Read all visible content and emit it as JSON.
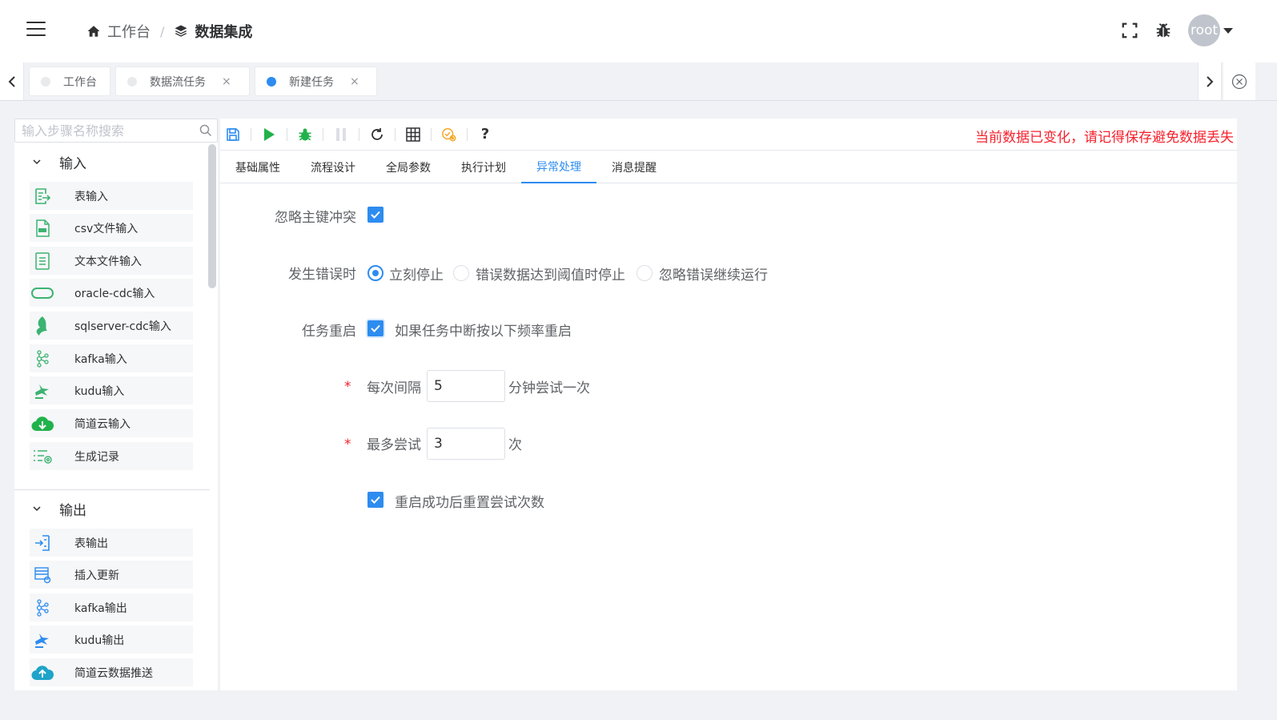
{
  "header": {
    "breadcrumb_home": "工作台",
    "breadcrumb_separator": "/",
    "breadcrumb_current": "数据集成",
    "user_name": "root",
    "icons": [
      "menu-icon",
      "home-icon",
      "layers-icon",
      "fullscreen-icon",
      "bug-icon",
      "caret-down-icon"
    ]
  },
  "tabs": [
    {
      "label": "工作台",
      "closable": false,
      "active": false
    },
    {
      "label": "数据流任务",
      "closable": true,
      "active": false
    },
    {
      "label": "新建任务",
      "closable": true,
      "active": true
    }
  ],
  "tab_close_glyph": "×",
  "sidebar": {
    "search_placeholder": "输入步骤名称搜索",
    "groups": [
      {
        "title": "输入",
        "items": [
          {
            "label": "表输入",
            "icon": "table-input-icon"
          },
          {
            "label": "csv文件输入",
            "icon": "csv-file-icon"
          },
          {
            "label": "文本文件输入",
            "icon": "text-file-icon"
          },
          {
            "label": "oracle-cdc输入",
            "icon": "oracle-icon"
          },
          {
            "label": "sqlserver-cdc输入",
            "icon": "sqlserver-icon"
          },
          {
            "label": "kafka输入",
            "icon": "kafka-icon"
          },
          {
            "label": "kudu输入",
            "icon": "kudu-icon"
          },
          {
            "label": "简道云输入",
            "icon": "cloud-download-icon"
          },
          {
            "label": "生成记录",
            "icon": "generate-records-icon"
          }
        ]
      },
      {
        "title": "输出",
        "items": [
          {
            "label": "表输出",
            "icon": "table-output-icon"
          },
          {
            "label": "插入更新",
            "icon": "insert-update-icon"
          },
          {
            "label": "kafka输出",
            "icon": "kafka-icon"
          },
          {
            "label": "kudu输出",
            "icon": "kudu-icon"
          },
          {
            "label": "简道云数据推送",
            "icon": "cloud-upload-icon"
          }
        ]
      }
    ]
  },
  "toolbar": {
    "icons": [
      "save-icon",
      "run-icon",
      "debug-icon",
      "pause-icon",
      "refresh-icon",
      "grid-icon",
      "settings-check-icon",
      "help-icon"
    ],
    "help_label": "?",
    "warning": "当前数据已变化，请记得保存避免数据丢失",
    "warning_color": "#f5222d"
  },
  "subtabs": [
    {
      "label": "基础属性",
      "active": false
    },
    {
      "label": "流程设计",
      "active": false
    },
    {
      "label": "全局参数",
      "active": false
    },
    {
      "label": "执行计划",
      "active": false
    },
    {
      "label": "异常处理",
      "active": true
    },
    {
      "label": "消息提醒",
      "active": false
    }
  ],
  "form": {
    "ignore_pk_conflict": {
      "label": "忽略主键冲突",
      "checked": true
    },
    "on_error": {
      "label": "发生错误时",
      "options": [
        {
          "label": "立刻停止",
          "checked": true
        },
        {
          "label": "错误数据达到阈值时停止",
          "checked": false
        },
        {
          "label": "忽略错误继续运行",
          "checked": false
        }
      ]
    },
    "task_restart": {
      "label": "任务重启",
      "checked": true,
      "option_text": "如果任务中断按以下频率重启"
    },
    "interval": {
      "required_mark": "*",
      "label": "每次间隔",
      "value": "5",
      "suffix": "分钟尝试一次"
    },
    "max_tries": {
      "required_mark": "*",
      "label": "最多尝试",
      "value": "3",
      "suffix": "次"
    },
    "reset_after_success": {
      "checked": true,
      "label": "重启成功后重置尝试次数"
    }
  },
  "accent_color": "#2d8cf0"
}
